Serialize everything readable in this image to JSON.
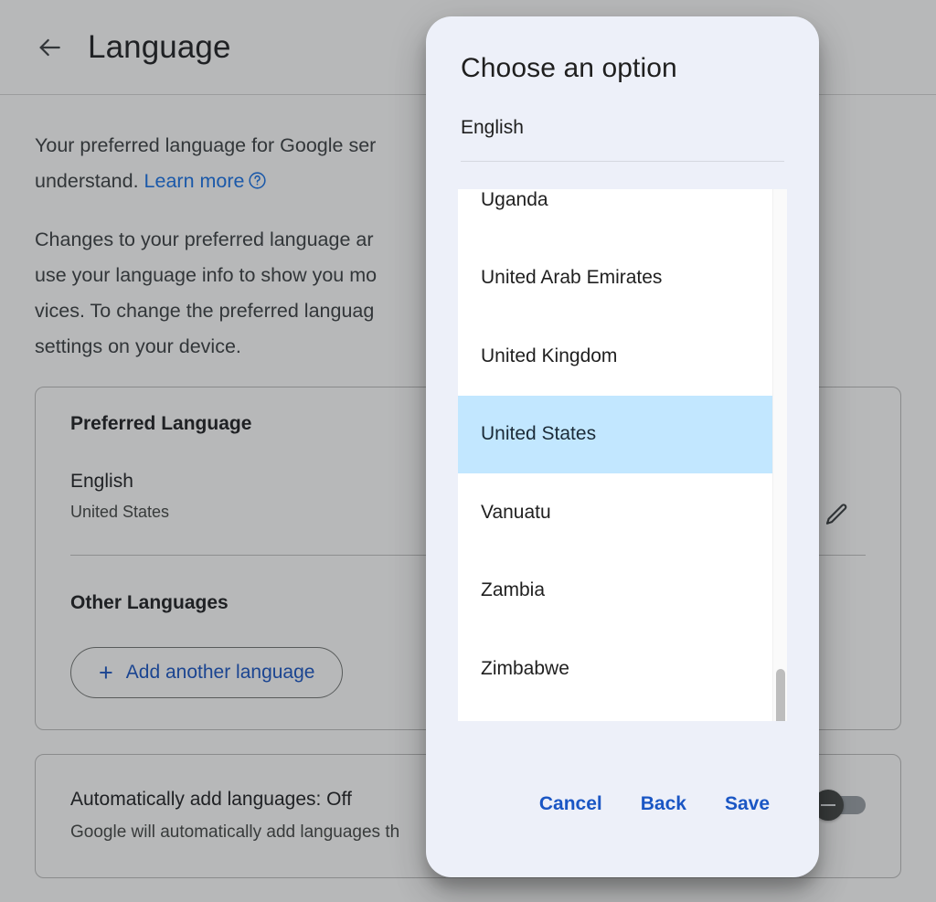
{
  "header": {
    "title": "Language",
    "back_icon": "arrow-left-icon"
  },
  "intro": {
    "paragraph1_prefix": "Your preferred language for Google ser",
    "paragraph1_continued": "understand. ",
    "learn_more": "Learn more",
    "help_icon": "help-circle-icon",
    "paragraph2_line1": "Changes to your preferred language ar",
    "paragraph2_line2": "use your language info to show you mo",
    "paragraph2_line3": "vices. To change the preferred languag",
    "paragraph2_line4": "settings on your device."
  },
  "preferred_card": {
    "section_title": "Preferred Language",
    "language_name": "English",
    "language_region": "United States",
    "edit_icon": "pencil-icon",
    "other_title": "Other Languages",
    "add_button_label": "Add another language",
    "add_button_icon": "plus-icon"
  },
  "auto_card": {
    "title": "Automatically add languages: Off",
    "description": "Google will automatically add languages th",
    "toggle_state": "off",
    "toggle_icon": "minus-icon"
  },
  "dialog": {
    "title": "Choose an option",
    "selected_value": "English",
    "options": [
      "Uganda",
      "United Arab Emirates",
      "United Kingdom",
      "United States",
      "Vanuatu",
      "Zambia",
      "Zimbabwe"
    ],
    "selected_option": "United States",
    "buttons": {
      "cancel": "Cancel",
      "back": "Back",
      "save": "Save"
    }
  },
  "colors": {
    "accent_link": "#1a56c4",
    "link_blue": "#1a73e8",
    "selection_blue": "#c2e7ff",
    "dialog_bg": "#edf0f9",
    "scrim": "rgba(32,33,36,.32)"
  }
}
